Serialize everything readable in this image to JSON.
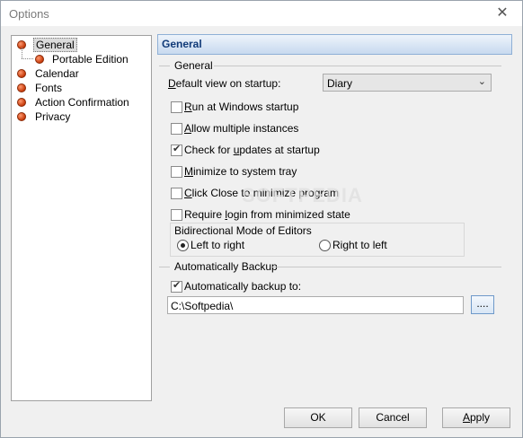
{
  "window": {
    "title": "Options",
    "close_glyph": "✕"
  },
  "tree": {
    "items": [
      {
        "label": "General",
        "selected": true
      },
      {
        "label": "Portable Edition",
        "child": true
      },
      {
        "label": "Calendar"
      },
      {
        "label": "Fonts"
      },
      {
        "label": "Action Confirmation"
      },
      {
        "label": "Privacy"
      }
    ]
  },
  "panel": {
    "header": "General",
    "general_group": "General",
    "default_view": {
      "label_prefix": "D",
      "label_rest": "efault view on startup:",
      "value": "Diary"
    },
    "options": [
      {
        "u": "R",
        "rest": "un at Windows startup",
        "checked": false
      },
      {
        "u": "A",
        "rest": "llow multiple instances",
        "checked": false
      },
      {
        "pre": "Check for ",
        "u": "u",
        "rest": "pdates at startup",
        "checked": true
      },
      {
        "u": "M",
        "rest": "inimize to system tray",
        "checked": false
      },
      {
        "u": "C",
        "rest": "lick Close to minimize program",
        "checked": false
      },
      {
        "pre": "Require ",
        "u": "l",
        "rest": "ogin from minimized state",
        "checked": false
      }
    ],
    "bidi": {
      "title": "Bidirectional Mode of Editors",
      "ltr": "Left to right",
      "rtl": "Right to left",
      "selected": "ltr"
    },
    "backup_group": "Automatically Backup",
    "backup": {
      "label": "Automatically backup to:",
      "checked": true,
      "path": "C:\\Softpedia\\",
      "browse": "...."
    }
  },
  "buttons": {
    "ok": "OK",
    "cancel": "Cancel",
    "apply_u": "A",
    "apply_rest": "pply"
  },
  "watermark": "SOFTPEDIA"
}
